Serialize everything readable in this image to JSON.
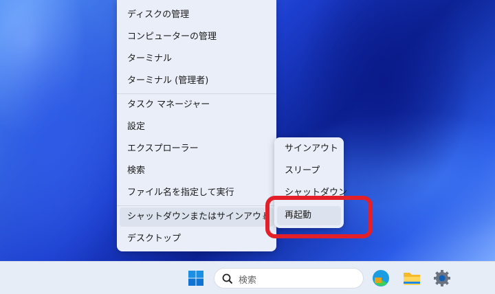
{
  "menu": {
    "items": [
      "ディスクの管理",
      "コンピューターの管理",
      "ターミナル",
      "ターミナル (管理者)",
      "タスク マネージャー",
      "設定",
      "エクスプローラー",
      "検索",
      "ファイル名を指定して実行",
      "シャットダウンまたはサインアウト",
      "デスクトップ"
    ]
  },
  "submenu": {
    "items": [
      "サインアウト",
      "スリープ",
      "シャットダウン",
      "再起動"
    ]
  },
  "taskbar": {
    "search_placeholder": "検索"
  },
  "colors": {
    "highlight": "#e3202a",
    "accent": "#0078d4"
  }
}
